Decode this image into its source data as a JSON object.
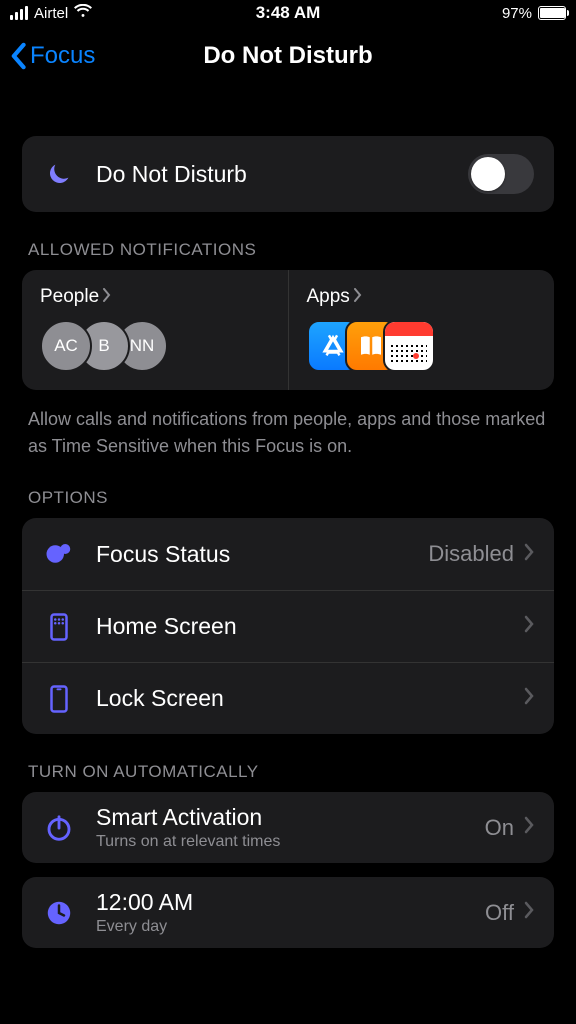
{
  "statusbar": {
    "carrier": "Airtel",
    "time": "3:48 AM",
    "battery_pct": "97%"
  },
  "nav": {
    "back_label": "Focus",
    "title": "Do Not Disturb"
  },
  "dnd": {
    "label": "Do Not Disturb",
    "enabled": false
  },
  "allowed": {
    "section": "ALLOWED NOTIFICATIONS",
    "people": {
      "label": "People",
      "avatars": [
        "AC",
        "B",
        "NN"
      ]
    },
    "apps": {
      "label": "Apps"
    },
    "footnote": "Allow calls and notifications from people, apps and those marked as Time Sensitive when this Focus is on."
  },
  "options": {
    "section": "OPTIONS",
    "focus_status": {
      "label": "Focus Status",
      "value": "Disabled"
    },
    "home_screen": {
      "label": "Home Screen"
    },
    "lock_screen": {
      "label": "Lock Screen"
    }
  },
  "automatic": {
    "section": "TURN ON AUTOMATICALLY",
    "smart": {
      "label": "Smart Activation",
      "subtitle": "Turns on at relevant times",
      "value": "On"
    },
    "schedule": {
      "label": "12:00 AM",
      "subtitle": "Every day",
      "value": "Off"
    }
  }
}
